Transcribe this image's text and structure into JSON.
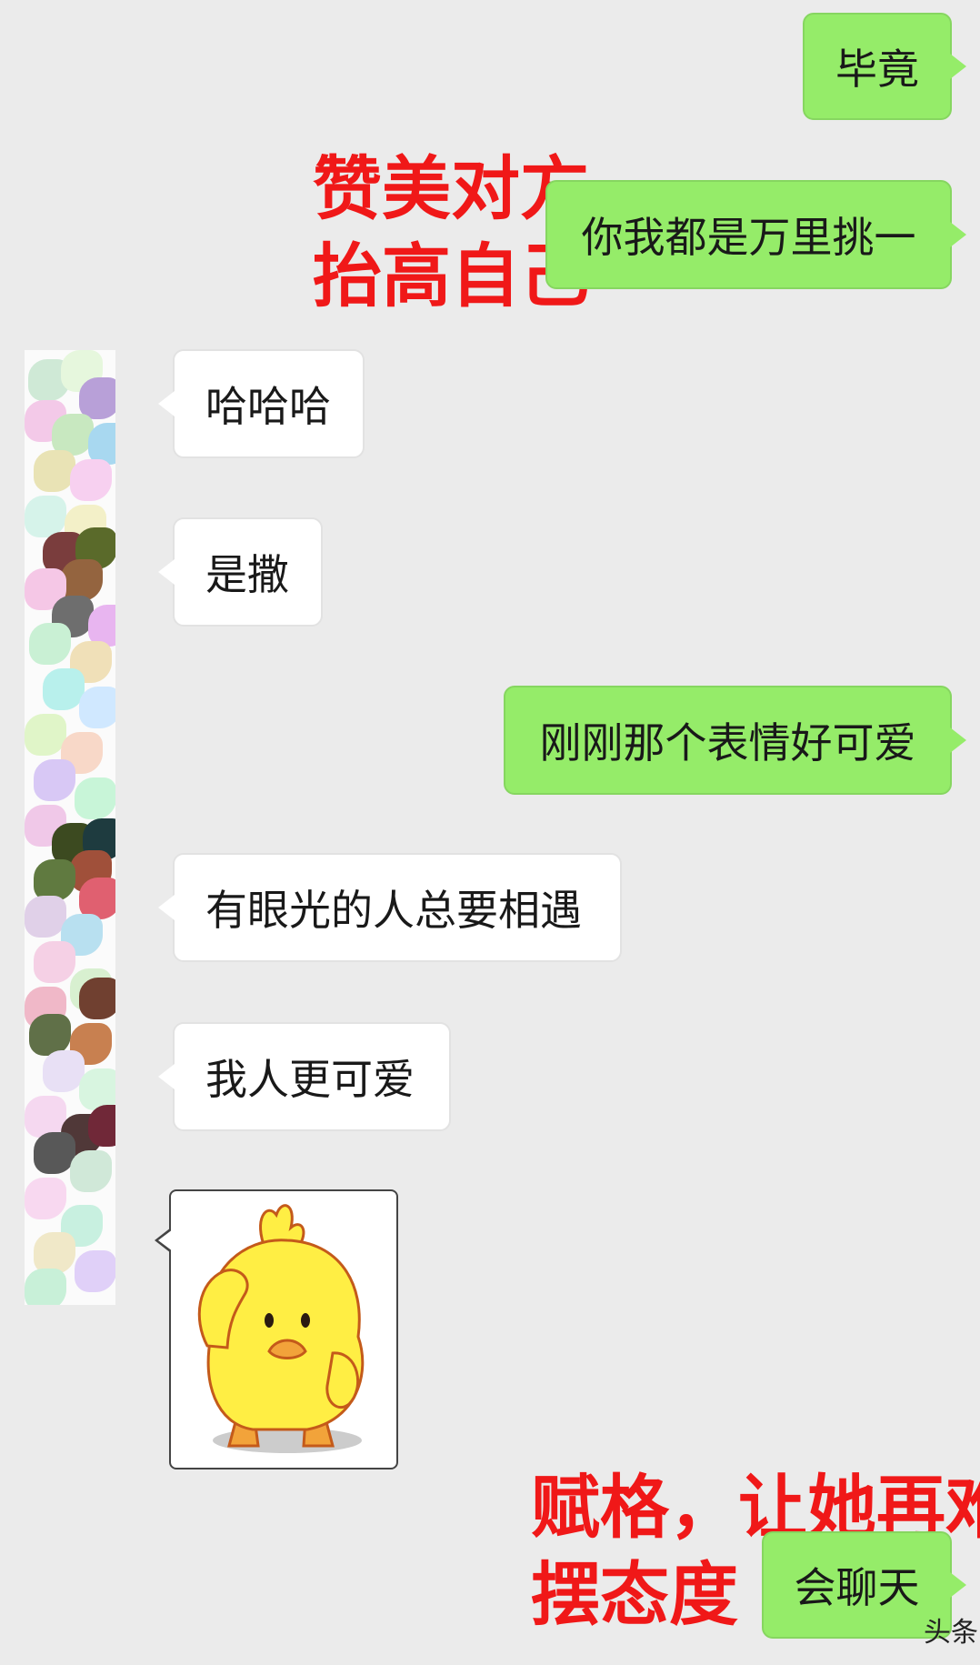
{
  "messages": [
    {
      "id": "m1",
      "side": "out",
      "text": "毕竟"
    },
    {
      "id": "m2",
      "side": "out",
      "text": "你我都是万里挑一"
    },
    {
      "id": "m3",
      "side": "in",
      "text": "哈哈哈"
    },
    {
      "id": "m4",
      "side": "in",
      "text": "是撒"
    },
    {
      "id": "m5",
      "side": "out",
      "text": "刚刚那个表情好可爱"
    },
    {
      "id": "m6",
      "side": "in",
      "text": "有眼光的人总要相遇"
    },
    {
      "id": "m7",
      "side": "in",
      "text": "我人更可爱"
    },
    {
      "id": "m8",
      "side": "in",
      "type": "sticker",
      "sticker": "yellow-duck-salute"
    },
    {
      "id": "m9",
      "side": "out",
      "text": "会聊天"
    }
  ],
  "annotations": {
    "first": {
      "line1": "赞美对方",
      "line2": "抬高自己"
    },
    "second": {
      "line1": "赋格，让她再难",
      "line2": "摆态度"
    }
  },
  "watermark": "头条",
  "colors": {
    "background": "#ebebeb",
    "outgoing_bubble": "#95ec69",
    "incoming_bubble": "#ffffff",
    "annotation": "#f01818"
  }
}
